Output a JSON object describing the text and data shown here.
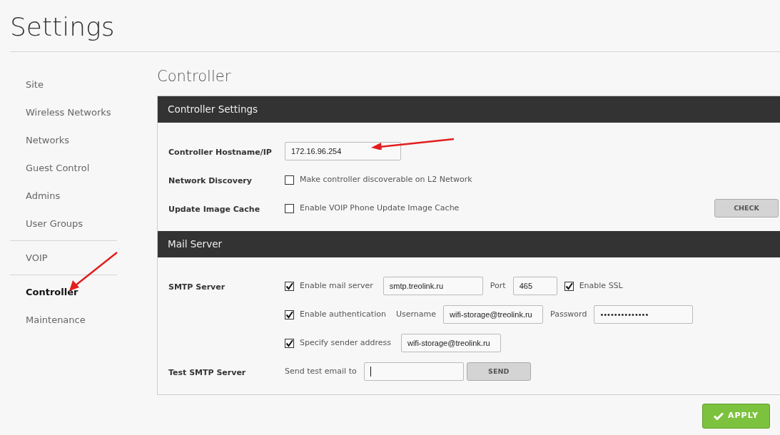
{
  "page_title": "Settings",
  "sidebar": {
    "groups": [
      [
        {
          "label": "Site",
          "selected": false
        },
        {
          "label": "Wireless Networks",
          "selected": false
        },
        {
          "label": "Networks",
          "selected": false
        },
        {
          "label": "Guest Control",
          "selected": false
        },
        {
          "label": "Admins",
          "selected": false
        },
        {
          "label": "User Groups",
          "selected": false
        }
      ],
      [
        {
          "label": "VOIP",
          "selected": false
        }
      ],
      [
        {
          "label": "Controller",
          "selected": true
        },
        {
          "label": "Maintenance",
          "selected": false
        }
      ]
    ]
  },
  "section_title": "Controller",
  "panels": [
    {
      "title": "Controller Settings",
      "rows": [
        {
          "label": "Controller Hostname/IP",
          "controls": [
            {
              "kind": "field",
              "value": "172.16.96.254"
            }
          ]
        },
        {
          "label": "Network Discovery",
          "controls": [
            {
              "kind": "checkbox",
              "label": "Make controller discoverable on L2 Network",
              "checked": false
            }
          ]
        },
        {
          "label": "Update Image Cache",
          "controls": [
            {
              "kind": "checkbox",
              "label": "Enable VOIP Phone Update Image Cache",
              "checked": false
            },
            {
              "kind": "side-button",
              "label": "CHECK"
            }
          ]
        }
      ]
    },
    {
      "title": "Mail Server",
      "rows": [
        {
          "label": "SMTP Server",
          "controls": [
            {
              "kind": "checkbox",
              "label": "Enable mail server",
              "checked": true
            },
            {
              "kind": "field",
              "value": "smtp.treolink.ru"
            },
            {
              "kind": "text",
              "text": "Port"
            },
            {
              "kind": "number",
              "value": "465"
            },
            {
              "kind": "checkbox",
              "label": "Enable SSL",
              "checked": true
            }
          ]
        },
        {
          "label": "",
          "controls": [
            {
              "kind": "checkbox",
              "label": "Enable authentication",
              "checked": true
            },
            {
              "kind": "text",
              "text": "Username"
            },
            {
              "kind": "field",
              "value": "wifi-storage@treolink.ru"
            },
            {
              "kind": "text",
              "text": "Password"
            },
            {
              "kind": "password",
              "value": "••••••••••••••"
            }
          ]
        },
        {
          "label": "",
          "controls": [
            {
              "kind": "checkbox",
              "label": "Specify sender address",
              "checked": true
            },
            {
              "kind": "field",
              "value": "wifi-storage@treolink.ru"
            }
          ]
        },
        {
          "label": "Test SMTP Server",
          "controls": [
            {
              "kind": "text",
              "text": "Send test email to"
            },
            {
              "kind": "field",
              "focused": true
            },
            {
              "kind": "button",
              "label": "SEND"
            }
          ]
        }
      ]
    }
  ],
  "apply_button": "APPLY"
}
